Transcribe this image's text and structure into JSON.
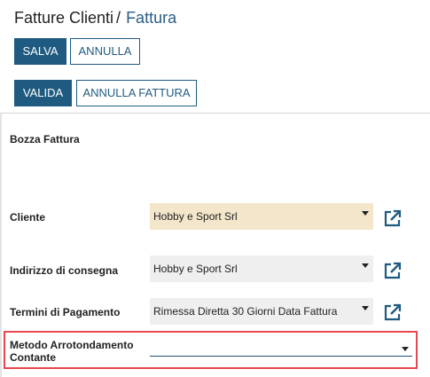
{
  "header": {
    "breadcrumb_parent": "Fatture Clienti",
    "breadcrumb_separator": "/",
    "breadcrumb_current": "Fattura"
  },
  "toolbar": {
    "save_label": "SALVA",
    "cancel_label": "ANNULLA"
  },
  "actions": {
    "validate_label": "VALIDA",
    "cancel_invoice_label": "ANNULLA FATTURA"
  },
  "form": {
    "section_title": "Bozza Fattura",
    "fields": {
      "cliente": {
        "label": "Cliente",
        "value": "Hobby e Sport Srl"
      },
      "indirizzo": {
        "label": "Indirizzo di consegna",
        "value": "Hobby e Sport Srl"
      },
      "termini": {
        "label": "Termini di Pagamento",
        "value": "Rimessa Diretta 30 Giorni Data Fattura"
      },
      "metodo": {
        "label_line1": "Metodo Arrotondamento",
        "label_line2": "Contante",
        "value": ""
      }
    }
  },
  "icons": {
    "external_link": "external-link-icon"
  },
  "colors": {
    "primary": "#1f5b80",
    "link": "#2a5d86",
    "highlight_field": "#f3e6cb",
    "field_bg": "#efefef",
    "focus_outline": "#e8474f"
  }
}
